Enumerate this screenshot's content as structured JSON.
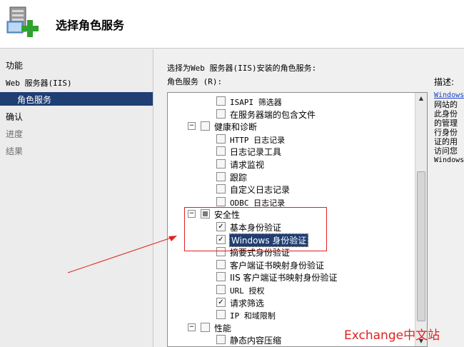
{
  "header": {
    "title": "选择角色服务"
  },
  "sidebar": {
    "items": [
      "功能",
      "Web 服务器(IIS)",
      "角色服务",
      "确认",
      "进度",
      "结果"
    ]
  },
  "main": {
    "instruction": "选择为Web 服务器(IIS)安装的角色服务:",
    "role_services_label": "角色服务 (R):",
    "description_label": "描述:",
    "description_lines": [
      "Windows",
      "网站的",
      "此身份",
      "的管理",
      "行身份",
      "证的用",
      "访问您",
      "Windows"
    ]
  },
  "tree": [
    {
      "label": "ISAPI 筛选器",
      "state": "unchecked",
      "level": 2,
      "mono": true
    },
    {
      "label": "在服务器端的包含文件",
      "state": "unchecked",
      "level": 2
    },
    {
      "label": "健康和诊断",
      "state": "unchecked",
      "level": 1,
      "expander": "−"
    },
    {
      "label": "HTTP 日志记录",
      "state": "unchecked",
      "level": 2,
      "mono": true
    },
    {
      "label": "日志记录工具",
      "state": "unchecked",
      "level": 2
    },
    {
      "label": "请求监视",
      "state": "unchecked",
      "level": 2
    },
    {
      "label": "跟踪",
      "state": "unchecked",
      "level": 2
    },
    {
      "label": "自定义日志记录",
      "state": "unchecked",
      "level": 2
    },
    {
      "label": "ODBC 日志记录",
      "state": "unchecked",
      "level": 2,
      "mono": true
    },
    {
      "label": "安全性",
      "state": "partial",
      "level": 1,
      "expander": "−"
    },
    {
      "label": "基本身份验证",
      "state": "checked",
      "level": 2
    },
    {
      "label": "Windows 身份验证",
      "state": "checked",
      "level": 2,
      "highlight": true
    },
    {
      "label": "摘要式身份验证",
      "state": "unchecked",
      "level": 2
    },
    {
      "label": "客户端证书映射身份验证",
      "state": "unchecked",
      "level": 2
    },
    {
      "label": "IIS 客户端证书映射身份验证",
      "state": "unchecked",
      "level": 2
    },
    {
      "label": "URL 授权",
      "state": "unchecked",
      "level": 2,
      "mono": true
    },
    {
      "label": "请求筛选",
      "state": "checked",
      "level": 2
    },
    {
      "label": "IP 和域限制",
      "state": "unchecked",
      "level": 2,
      "mono": true
    },
    {
      "label": "性能",
      "state": "unchecked",
      "level": 1,
      "expander": "−"
    },
    {
      "label": "静态内容压缩",
      "state": "unchecked",
      "level": 2
    }
  ],
  "check_glyph": "✓",
  "scroll": {
    "up": "▲",
    "down": "▼"
  },
  "watermark": "Exchange中文站",
  "colors": {
    "selection": "#1f3e73",
    "annotation": "#e02020",
    "link": "#1a3fbf"
  }
}
